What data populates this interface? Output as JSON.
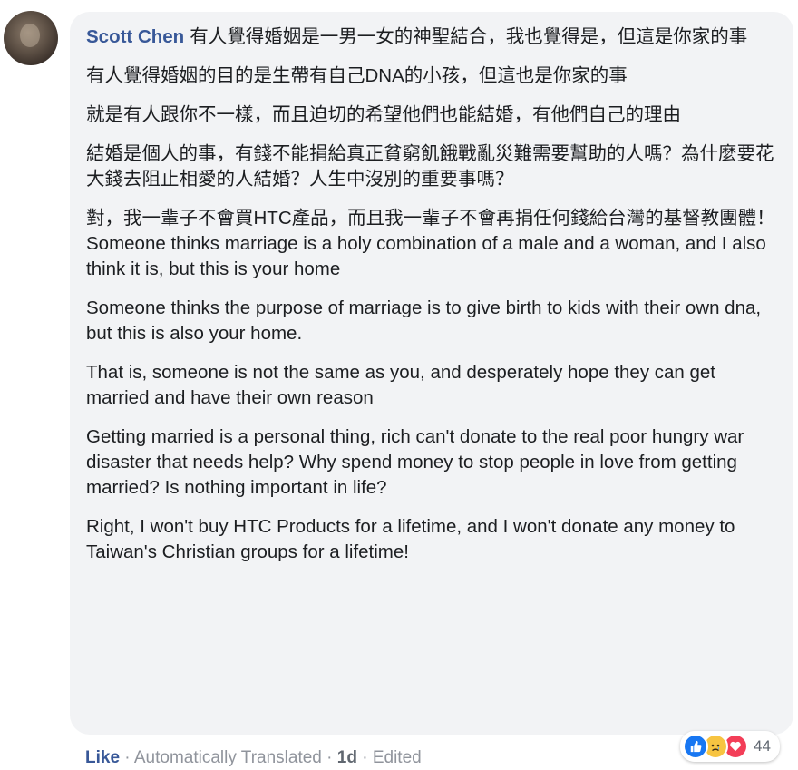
{
  "comment": {
    "author": "Scott Chen",
    "paragraphs": [
      "有人覺得婚姻是一男一女的神聖結合，我也覺得是，但這是你家的事",
      "有人覺得婚姻的目的是生帶有自己DNA的小孩，但這也是你家的事",
      "就是有人跟你不一樣，而且迫切的希望他們也能結婚，有他們自己的理由",
      "結婚是個人的事，有錢不能捐給真正貧窮飢餓戰亂災難需要幫助的人嗎？為什麼要花大錢去阻止相愛的人結婚？人生中沒別的重要事嗎？",
      "對，我一輩子不會買HTC產品，而且我一輩子不會再捐任何錢給台灣的基督教團體！",
      "Someone thinks marriage is a holy combination of a male and a woman, and I also think it is, but this is your home",
      "Someone thinks the purpose of marriage is to give birth to kids with their own dna, but this is also your home.",
      "That is, someone is not the same as you, and desperately hope they can get married and have their own reason",
      "Getting married is a personal thing, rich can't donate to the real poor hungry war disaster that needs help? Why spend money to stop people in love from getting married? Is nothing important in life?",
      "Right, I won't buy HTC Products for a lifetime, and I won't donate any money to Taiwan's Christian groups for a lifetime!"
    ]
  },
  "reactions": {
    "icons": [
      "like-icon",
      "sad-icon",
      "love-icon"
    ],
    "count": "44"
  },
  "footer": {
    "like_label": "Like",
    "separator": " · ",
    "translated_label": "Automatically Translated",
    "time_label": "1d",
    "edited_label": "Edited"
  },
  "colors": {
    "author": "#385898",
    "bubble": "#f2f3f5",
    "like": "#1877f2",
    "sad": "#f7c441",
    "love": "#f33e58"
  }
}
